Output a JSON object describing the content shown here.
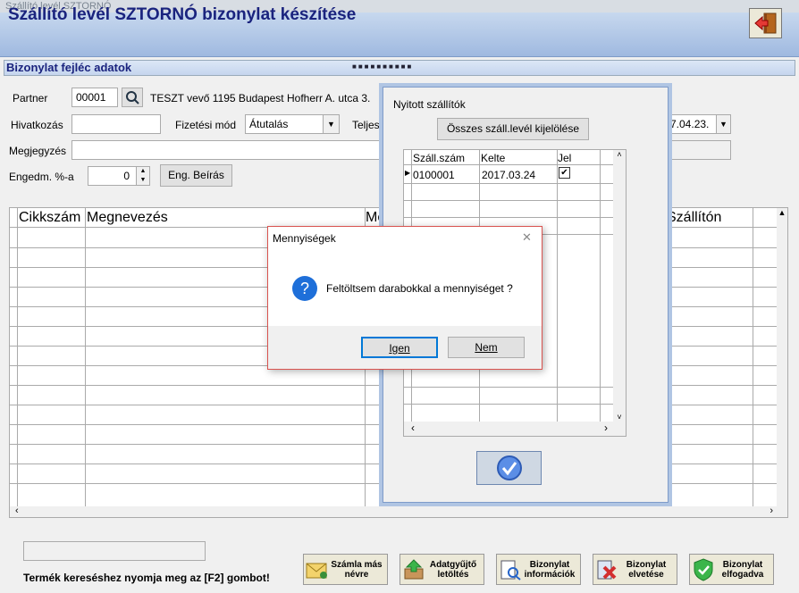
{
  "window": {
    "title": "Szállító levél SZTORNÓ"
  },
  "header": {
    "title": "Szállító levél SZTORNÓ bizonylat készítése",
    "exit_icon": "exit-door-icon"
  },
  "section": {
    "title": "Bizonylat fejléc adatok",
    "dots": "■■■■■■■■■■"
  },
  "form": {
    "partner_label": "Partner",
    "partner_code": "00001",
    "partner_text": "TESZT vevő 1195 Budapest Hofherr A. utca 3.",
    "hivatkozas_label": "Hivatkozás",
    "hivatkozas_value": "",
    "fizetesi_label": "Fizetési mód",
    "fizetesi_value": "Átutalás",
    "teljes_label": "Teljes",
    "date_value": "7.04.23.",
    "megjegyzes_label": "Megjegyzés",
    "megjegyzes_value": "",
    "engedm_label": "Engedm. %-a",
    "engedm_value": "0",
    "eng_button": "Eng. Beírás"
  },
  "grid": {
    "columns": [
      "Cikkszám",
      "Megnevezés",
      "Me",
      "Szállítón"
    ]
  },
  "panel": {
    "title": "Nyitott szállítók",
    "select_all": "Összes száll.levél kijelölése",
    "columns": [
      "Száll.szám",
      "Kelte",
      "Jel"
    ],
    "rows": [
      {
        "szam": "0100001",
        "kelte": "2017.03.24",
        "jel": "✔"
      }
    ]
  },
  "dialog": {
    "title": "Mennyiségek",
    "message": "Feltöltsem darabokkal a mennyiséget ?",
    "yes": "Igen",
    "no": "Nem",
    "close": "✕"
  },
  "footer": {
    "hint": "Termék kereséshez nyomja meg az [F2] gombot!",
    "buttons": [
      {
        "label": "Számla más névre"
      },
      {
        "label": "Adatgyűjtő letöltés"
      },
      {
        "label": "Bizonylat információk"
      },
      {
        "label": "Bizonylat elvetése"
      },
      {
        "label": "Bizonylat elfogadva"
      }
    ]
  }
}
